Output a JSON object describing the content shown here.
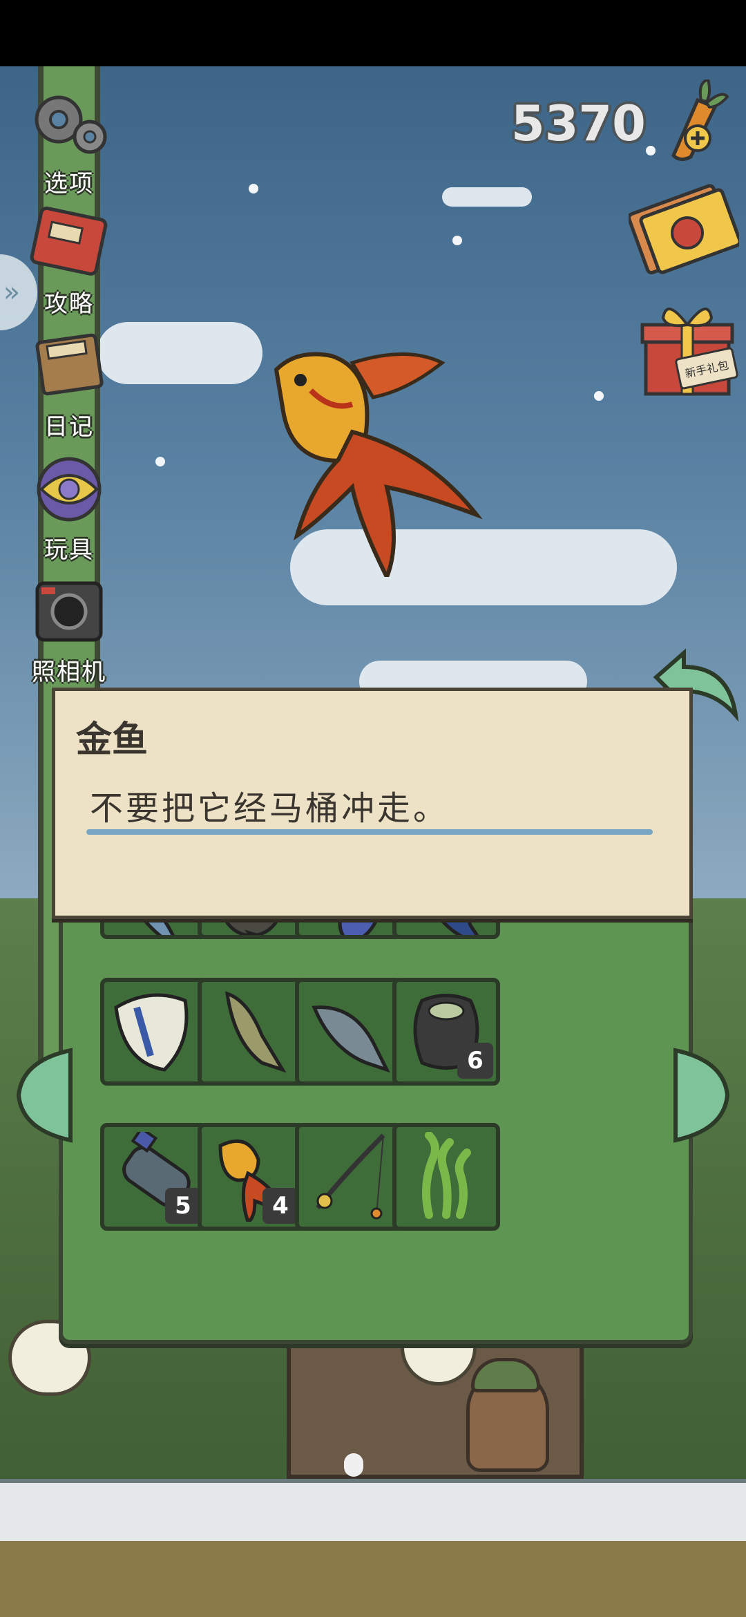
{
  "currency": {
    "amount": "5370",
    "carrot_icon": "carrot-plus-icon"
  },
  "sidebar": {
    "items": [
      {
        "label": "选项",
        "icon": "gear-icon"
      },
      {
        "label": "攻略",
        "icon": "guidebook-icon"
      },
      {
        "label": "日记",
        "icon": "diary-icon"
      },
      {
        "label": "玩具",
        "icon": "toy-ball-icon"
      },
      {
        "label": "照相机",
        "icon": "camera-icon"
      }
    ],
    "expand_glyph": "»"
  },
  "right_menu": {
    "gift_label": "新手礼包"
  },
  "dialog": {
    "title": "金鱼",
    "description": "不要把它经马桶冲走。"
  },
  "inventory": {
    "slots": [
      {
        "item": "sardine",
        "count": ""
      },
      {
        "item": "flounder",
        "count": ""
      },
      {
        "item": "swordfish",
        "count": ""
      },
      {
        "item": "tuna",
        "count": ""
      },
      {
        "item": "butterflyfish",
        "count": ""
      },
      {
        "item": "carp",
        "count": ""
      },
      {
        "item": "trout",
        "count": ""
      },
      {
        "item": "broken-pot",
        "count": "6"
      },
      {
        "item": "plastic-bottle",
        "count": "5"
      },
      {
        "item": "goldfish",
        "count": "4"
      },
      {
        "item": "fishing-rod",
        "count": ""
      },
      {
        "item": "seaweed",
        "count": ""
      }
    ]
  },
  "colors": {
    "panel_green": "#5f9552",
    "slot_green": "#3f6d3a",
    "dialog_bg": "#eee2c6",
    "underline_blue": "#79a7c3"
  }
}
